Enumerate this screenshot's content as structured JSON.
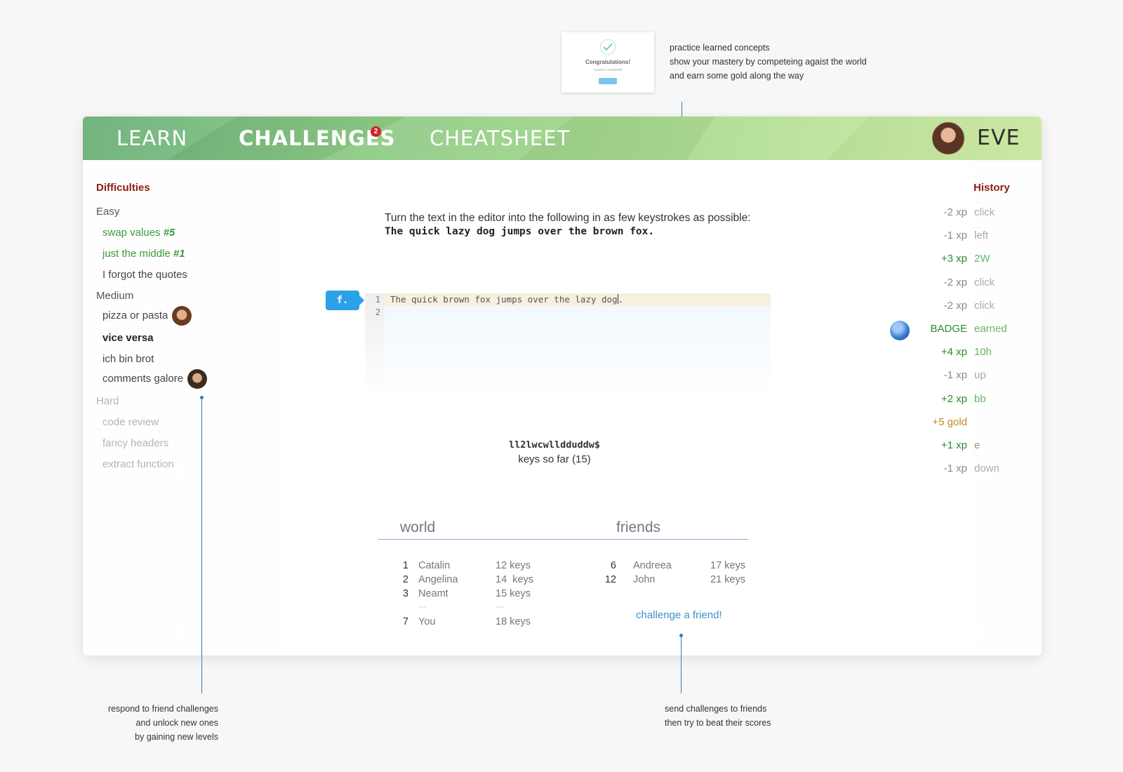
{
  "annotations": {
    "top": [
      "practice learned concepts",
      "show your mastery by competeing agaist the world",
      "and earn some gold along the way"
    ],
    "left": [
      "respond to friend challenges",
      "and unlock new ones",
      "by gaining new levels"
    ],
    "right": [
      "send challenges to friends",
      "then try to beat their scores"
    ],
    "thumbnail": {
      "title": "Congratulations!",
      "subtitle": "Lesson completed",
      "button": "Next"
    }
  },
  "nav": {
    "items": [
      {
        "label": "LEARN"
      },
      {
        "label": "CHALLENGES"
      },
      {
        "label": "CHEATSHEET"
      }
    ],
    "badge_count": "2",
    "user_name": "EVE"
  },
  "sidebar": {
    "title": "Difficulties",
    "easy": "Easy",
    "easy_items": [
      {
        "label": "swap values ",
        "rank": "#5"
      },
      {
        "label": "just the middle ",
        "rank": "#1"
      },
      {
        "label": "I forgot the quotes"
      }
    ],
    "medium": "Medium",
    "medium_items": [
      {
        "label": "pizza or pasta"
      },
      {
        "label": "vice versa"
      },
      {
        "label": "ich bin brot"
      },
      {
        "label": "comments galore"
      }
    ],
    "hard": "Hard",
    "hard_items": [
      {
        "label": "code review"
      },
      {
        "label": "fancy headers"
      },
      {
        "label": "extract function"
      }
    ]
  },
  "challenge": {
    "instruction": "Turn the text in the editor into the following in as few keystrokes as possible:",
    "target": "The quick lazy dog jumps over the brown fox.",
    "mode_tag": "f.",
    "line_numbers": [
      "1",
      "2"
    ],
    "code_line_before_cursor": "The quick brown fox jumps over the lazy dog",
    "code_line_after_cursor": ".",
    "keys_sequence": "ll2lwcwlldduddw$",
    "keys_label": "keys so far (15)"
  },
  "leaderboard": {
    "world_title": "world",
    "friends_title": "friends",
    "world": [
      {
        "rank": "1",
        "name": "Catalin",
        "keys": "12 keys"
      },
      {
        "rank": "2",
        "name": "Angelina",
        "keys": "14  keys"
      },
      {
        "rank": "3",
        "name": "Neamt",
        "keys": "15 keys"
      },
      {
        "rank": "",
        "name": "...",
        "keys": "..."
      },
      {
        "rank": "7",
        "name": "You",
        "keys": "18 keys"
      }
    ],
    "friends": [
      {
        "rank": "6",
        "name": "Andreea",
        "keys": "17 keys"
      },
      {
        "rank": "12",
        "name": "John",
        "keys": "21 keys"
      }
    ],
    "challenge_link": "challenge a friend!"
  },
  "history": {
    "title": "History",
    "rows": [
      {
        "value": "-2 xp",
        "action": "click",
        "kind": "neg"
      },
      {
        "value": "-1 xp",
        "action": "left",
        "kind": "neg"
      },
      {
        "value": "+3 xp",
        "action": "2W",
        "kind": "pos"
      },
      {
        "value": "-2 xp",
        "action": "click",
        "kind": "neg"
      },
      {
        "value": "-2 xp",
        "action": "click",
        "kind": "neg"
      },
      {
        "value": "BADGE",
        "action": "earned",
        "kind": "badge"
      },
      {
        "value": "+4 xp",
        "action": "10h",
        "kind": "pos"
      },
      {
        "value": "-1 xp",
        "action": "up",
        "kind": "neg"
      },
      {
        "value": "+2 xp",
        "action": "bb",
        "kind": "pos"
      },
      {
        "value": "+5 gold",
        "action": "",
        "kind": "gold"
      },
      {
        "value": "+1 xp",
        "action": "e",
        "kind": "pos"
      },
      {
        "value": "-1 xp",
        "action": "down",
        "kind": "neg"
      }
    ]
  }
}
